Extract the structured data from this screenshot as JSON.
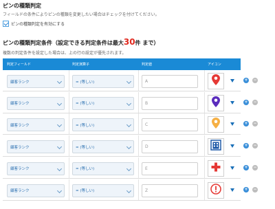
{
  "section1": {
    "title": "ピンの種類判定",
    "description": "フィールドの条件によりピンの種類を変更したい場合はチェックを付けてください。",
    "checkbox_label": "ピンの種類判定を有効にする",
    "checked": true
  },
  "section2": {
    "title_prefix": "ピンの種類判定条件（設定できる判定条件は最大",
    "max_count": "30",
    "title_suffix": "件 まで）",
    "description": "複数の判定条件を設定した場合は、上の行の設定が優先されます。"
  },
  "table": {
    "headers": [
      "判定フィールド",
      "判定演算子",
      "判定値",
      "アイコン"
    ],
    "rows": [
      {
        "field": "顧客ランク",
        "operator": "= (等しい)",
        "value": "A",
        "icon": "map-pin-red-icon"
      },
      {
        "field": "顧客ランク",
        "operator": "= (等しい)",
        "value": "B",
        "icon": "map-pin-purple-icon"
      },
      {
        "field": "顧客ランク",
        "operator": "= (等しい)",
        "value": "C",
        "icon": "map-pin-orange-icon"
      },
      {
        "field": "顧客ランク",
        "operator": "= (等しい)",
        "value": "D",
        "icon": "building-icon"
      },
      {
        "field": "顧客ランク",
        "operator": "= (等しい)",
        "value": "E",
        "icon": "hospital-cross-icon"
      },
      {
        "field": "顧客ランク",
        "operator": "= (等しい)",
        "value": "Z",
        "icon": "exclamation-icon"
      }
    ]
  },
  "buttons": {
    "add": "+",
    "remove": "−"
  },
  "colors": {
    "accent": "#1a8ad6",
    "highlight": "#e0281e"
  }
}
